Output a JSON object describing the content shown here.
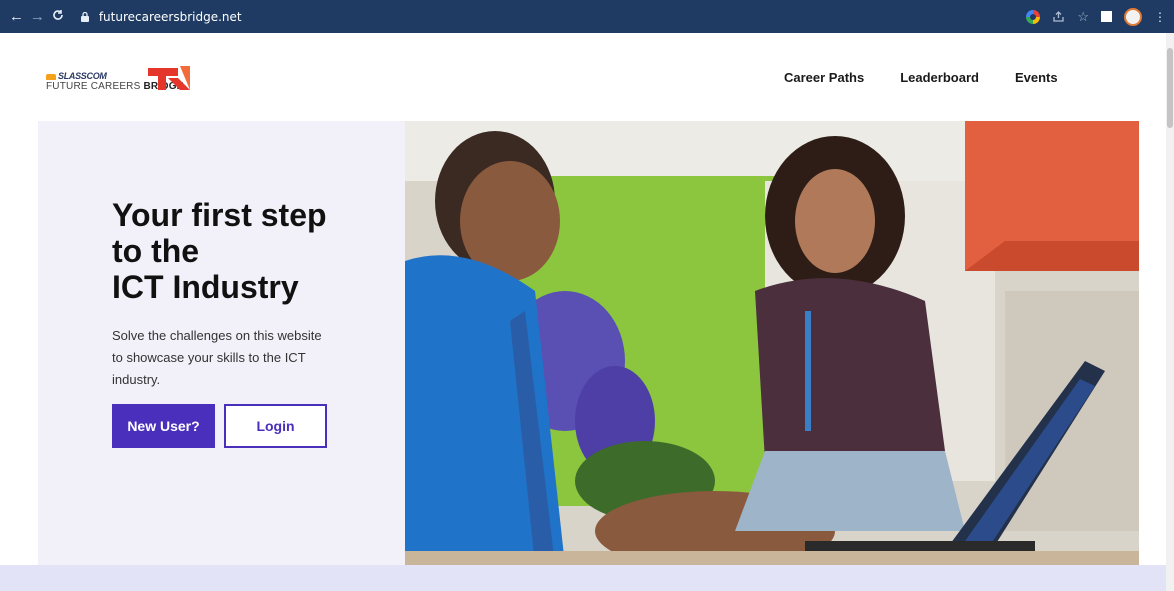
{
  "browser": {
    "url": "futurecareersbridge.net",
    "icons": [
      "back-arrow-icon",
      "forward-arrow-icon",
      "reload-icon",
      "lock-icon",
      "google-icon",
      "share-icon",
      "star-icon",
      "sidepanel-icon",
      "profile-icon",
      "menu-icon"
    ]
  },
  "logo": {
    "slasscom": "SLASSCOM",
    "line_regular": "FUTURE CAREERS ",
    "line_bold": "BRIDGE"
  },
  "nav": {
    "items": [
      {
        "label": "Career Paths"
      },
      {
        "label": "Leaderboard"
      },
      {
        "label": "Events"
      }
    ]
  },
  "hero": {
    "title_line1": "Your first step",
    "title_line2": "to the",
    "title_line3": "ICT Industry",
    "description": "Solve the challenges on this website to showcase your skills to the ICT industry.",
    "new_user_label": "New User?",
    "login_label": "Login"
  },
  "colors": {
    "brand_purple": "#4a2fbd",
    "browser_bar": "#1f3b64",
    "hero_bg": "#f2f1f9",
    "band": "#e3e3f8",
    "logo_red": "#e5362b"
  }
}
